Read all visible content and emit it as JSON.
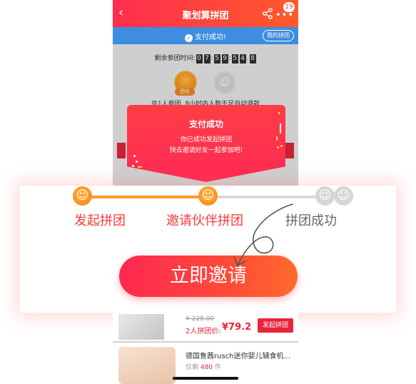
{
  "header": {
    "title": "聚划算拼团",
    "back_icon": "‹",
    "more_icon": "•••",
    "badge_count": "19"
  },
  "status_bar": {
    "text": "支付成功!",
    "my_group_label": "我的拼团"
  },
  "countdown": {
    "label": "剩余参团时间:",
    "digits": [
      "0",
      "7",
      "5",
      "9",
      "5",
      "4",
      "8"
    ]
  },
  "group": {
    "leader_tag": "团长",
    "info": "共1人参团, 8小时内人数不足自动退款"
  },
  "popup": {
    "title": "支付成功",
    "line1": "你已成功发起拼团",
    "line2": "快去邀请好友一起参加吧!"
  },
  "stepper": {
    "progress_fraction": 0.5,
    "steps": [
      {
        "label": "发起拼团",
        "state": "done"
      },
      {
        "label": "邀请伙伴拼团",
        "state": "current"
      },
      {
        "label": "拼团成功",
        "state": "pending"
      }
    ],
    "smiley_glyph": "☺"
  },
  "invite_button": {
    "label": "立即邀请"
  },
  "products": [
    {
      "old_price": "¥ 228.00",
      "price_label": "2人拼团价:",
      "price": "¥79.2",
      "button": "发起拼团"
    },
    {
      "name": "德国鲁茜rusch迷你婴儿辅食机...",
      "sold_prefix": "仅剩",
      "sold_count": "480",
      "sold_suffix": "件"
    }
  ],
  "colors": {
    "brand_red": "#ff2d4f",
    "step_orange": "#ff8c1c",
    "status_blue": "#3d8de0"
  }
}
